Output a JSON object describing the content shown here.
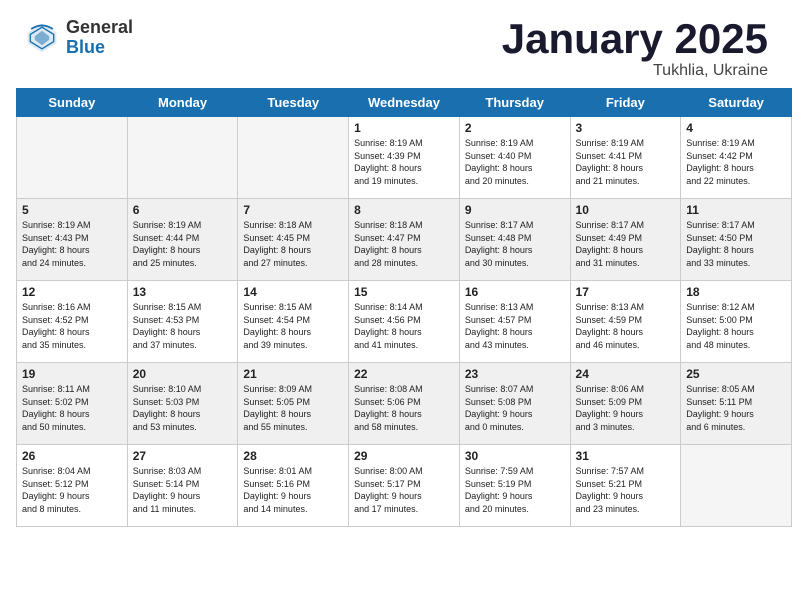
{
  "header": {
    "logo_general": "General",
    "logo_blue": "Blue",
    "month_title": "January 2025",
    "subtitle": "Tukhlia, Ukraine"
  },
  "weekdays": [
    "Sunday",
    "Monday",
    "Tuesday",
    "Wednesday",
    "Thursday",
    "Friday",
    "Saturday"
  ],
  "weeks": [
    [
      {
        "day": "",
        "info": ""
      },
      {
        "day": "",
        "info": ""
      },
      {
        "day": "",
        "info": ""
      },
      {
        "day": "1",
        "info": "Sunrise: 8:19 AM\nSunset: 4:39 PM\nDaylight: 8 hours\nand 19 minutes."
      },
      {
        "day": "2",
        "info": "Sunrise: 8:19 AM\nSunset: 4:40 PM\nDaylight: 8 hours\nand 20 minutes."
      },
      {
        "day": "3",
        "info": "Sunrise: 8:19 AM\nSunset: 4:41 PM\nDaylight: 8 hours\nand 21 minutes."
      },
      {
        "day": "4",
        "info": "Sunrise: 8:19 AM\nSunset: 4:42 PM\nDaylight: 8 hours\nand 22 minutes."
      }
    ],
    [
      {
        "day": "5",
        "info": "Sunrise: 8:19 AM\nSunset: 4:43 PM\nDaylight: 8 hours\nand 24 minutes."
      },
      {
        "day": "6",
        "info": "Sunrise: 8:19 AM\nSunset: 4:44 PM\nDaylight: 8 hours\nand 25 minutes."
      },
      {
        "day": "7",
        "info": "Sunrise: 8:18 AM\nSunset: 4:45 PM\nDaylight: 8 hours\nand 27 minutes."
      },
      {
        "day": "8",
        "info": "Sunrise: 8:18 AM\nSunset: 4:47 PM\nDaylight: 8 hours\nand 28 minutes."
      },
      {
        "day": "9",
        "info": "Sunrise: 8:17 AM\nSunset: 4:48 PM\nDaylight: 8 hours\nand 30 minutes."
      },
      {
        "day": "10",
        "info": "Sunrise: 8:17 AM\nSunset: 4:49 PM\nDaylight: 8 hours\nand 31 minutes."
      },
      {
        "day": "11",
        "info": "Sunrise: 8:17 AM\nSunset: 4:50 PM\nDaylight: 8 hours\nand 33 minutes."
      }
    ],
    [
      {
        "day": "12",
        "info": "Sunrise: 8:16 AM\nSunset: 4:52 PM\nDaylight: 8 hours\nand 35 minutes."
      },
      {
        "day": "13",
        "info": "Sunrise: 8:15 AM\nSunset: 4:53 PM\nDaylight: 8 hours\nand 37 minutes."
      },
      {
        "day": "14",
        "info": "Sunrise: 8:15 AM\nSunset: 4:54 PM\nDaylight: 8 hours\nand 39 minutes."
      },
      {
        "day": "15",
        "info": "Sunrise: 8:14 AM\nSunset: 4:56 PM\nDaylight: 8 hours\nand 41 minutes."
      },
      {
        "day": "16",
        "info": "Sunrise: 8:13 AM\nSunset: 4:57 PM\nDaylight: 8 hours\nand 43 minutes."
      },
      {
        "day": "17",
        "info": "Sunrise: 8:13 AM\nSunset: 4:59 PM\nDaylight: 8 hours\nand 46 minutes."
      },
      {
        "day": "18",
        "info": "Sunrise: 8:12 AM\nSunset: 5:00 PM\nDaylight: 8 hours\nand 48 minutes."
      }
    ],
    [
      {
        "day": "19",
        "info": "Sunrise: 8:11 AM\nSunset: 5:02 PM\nDaylight: 8 hours\nand 50 minutes."
      },
      {
        "day": "20",
        "info": "Sunrise: 8:10 AM\nSunset: 5:03 PM\nDaylight: 8 hours\nand 53 minutes."
      },
      {
        "day": "21",
        "info": "Sunrise: 8:09 AM\nSunset: 5:05 PM\nDaylight: 8 hours\nand 55 minutes."
      },
      {
        "day": "22",
        "info": "Sunrise: 8:08 AM\nSunset: 5:06 PM\nDaylight: 8 hours\nand 58 minutes."
      },
      {
        "day": "23",
        "info": "Sunrise: 8:07 AM\nSunset: 5:08 PM\nDaylight: 9 hours\nand 0 minutes."
      },
      {
        "day": "24",
        "info": "Sunrise: 8:06 AM\nSunset: 5:09 PM\nDaylight: 9 hours\nand 3 minutes."
      },
      {
        "day": "25",
        "info": "Sunrise: 8:05 AM\nSunset: 5:11 PM\nDaylight: 9 hours\nand 6 minutes."
      }
    ],
    [
      {
        "day": "26",
        "info": "Sunrise: 8:04 AM\nSunset: 5:12 PM\nDaylight: 9 hours\nand 8 minutes."
      },
      {
        "day": "27",
        "info": "Sunrise: 8:03 AM\nSunset: 5:14 PM\nDaylight: 9 hours\nand 11 minutes."
      },
      {
        "day": "28",
        "info": "Sunrise: 8:01 AM\nSunset: 5:16 PM\nDaylight: 9 hours\nand 14 minutes."
      },
      {
        "day": "29",
        "info": "Sunrise: 8:00 AM\nSunset: 5:17 PM\nDaylight: 9 hours\nand 17 minutes."
      },
      {
        "day": "30",
        "info": "Sunrise: 7:59 AM\nSunset: 5:19 PM\nDaylight: 9 hours\nand 20 minutes."
      },
      {
        "day": "31",
        "info": "Sunrise: 7:57 AM\nSunset: 5:21 PM\nDaylight: 9 hours\nand 23 minutes."
      },
      {
        "day": "",
        "info": ""
      }
    ]
  ]
}
